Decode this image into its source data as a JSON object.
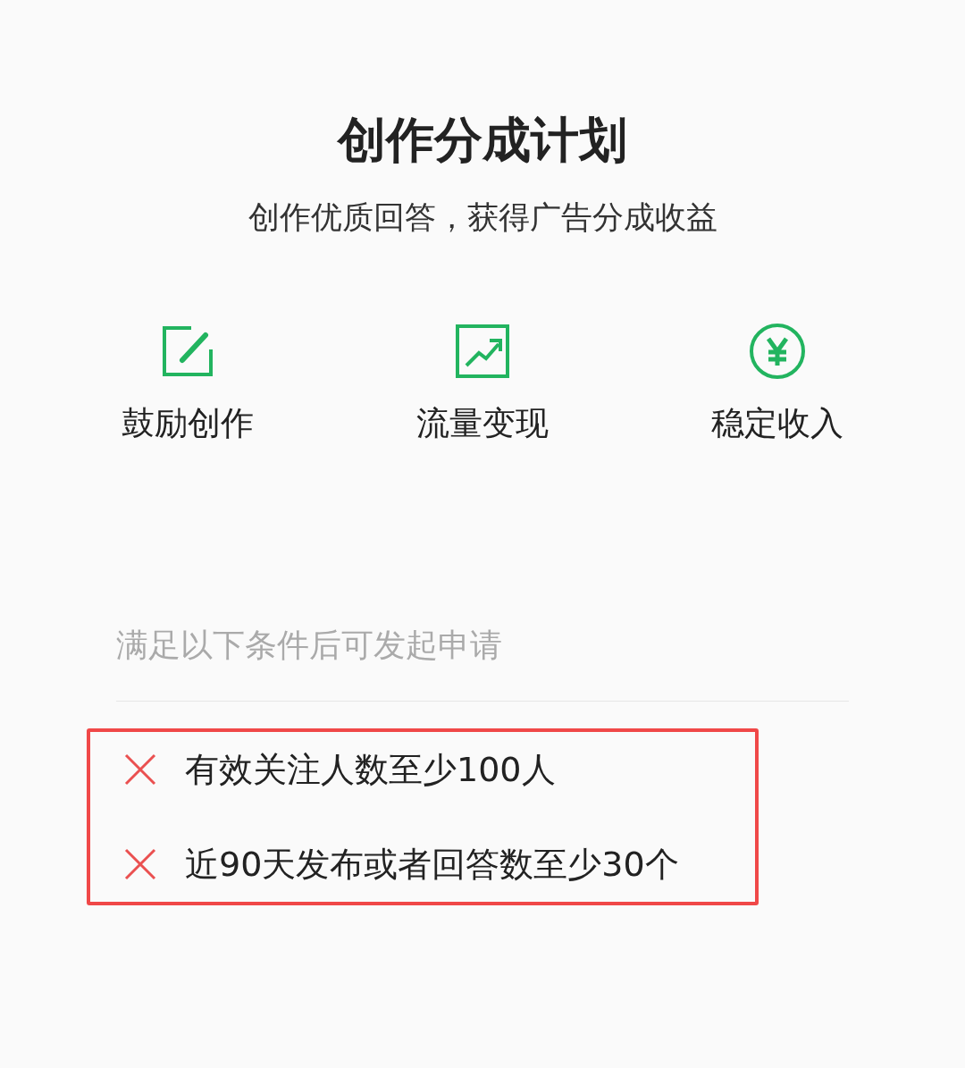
{
  "title": "创作分成计划",
  "subtitle": "创作优质回答，获得广告分成收益",
  "features": [
    {
      "kind": "edit",
      "label": "鼓励创作"
    },
    {
      "kind": "chart",
      "label": "流量变现"
    },
    {
      "kind": "yen",
      "label": "稳定收入"
    }
  ],
  "conditions": {
    "heading": "满足以下条件后可发起申请",
    "items": [
      {
        "met": false,
        "text": "有效关注人数至少100人"
      },
      {
        "met": false,
        "text": "近90天发布或者回答数至少30个"
      }
    ]
  }
}
